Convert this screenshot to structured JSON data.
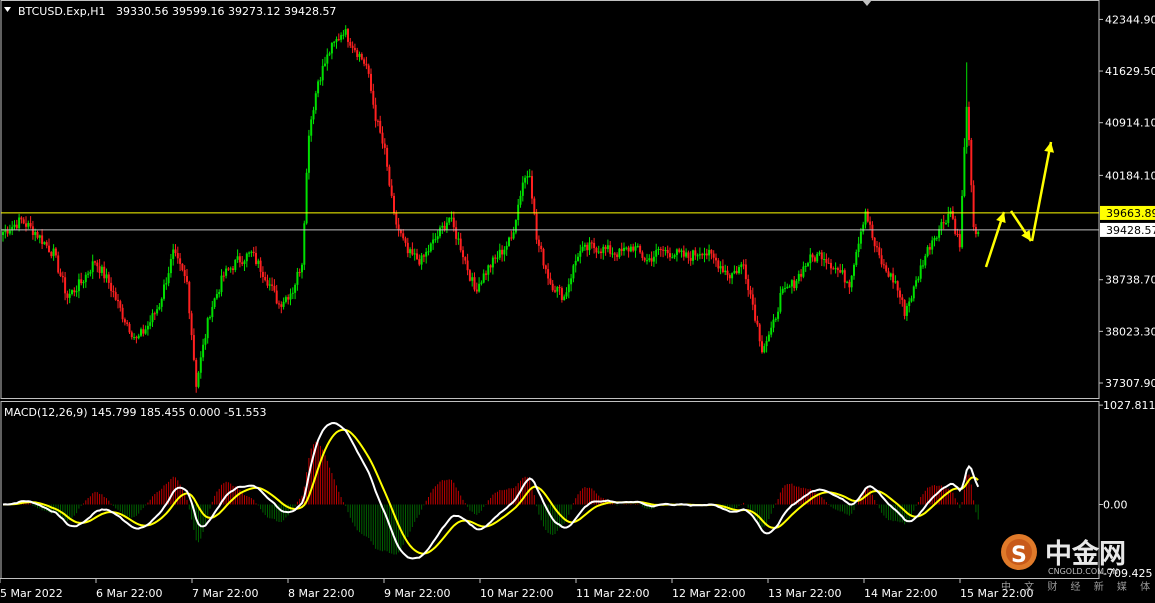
{
  "chart_data": [
    {
      "type": "candlestick",
      "symbol_header": "BTCUSD.Exp,H1",
      "ohlc_header": "39330.56 39599.16 39273.12 39428.57",
      "price_ticks": [
        {
          "label": "42344.90",
          "value": 42344.9
        },
        {
          "label": "41629.50",
          "value": 41629.5
        },
        {
          "label": "40914.10",
          "value": 40914.1
        },
        {
          "label": "40184.10",
          "value": 40184.1
        },
        {
          "label": "38738.70",
          "value": 38738.7
        },
        {
          "label": "38023.30",
          "value": 38023.3
        },
        {
          "label": "37307.90",
          "value": 37307.9
        }
      ],
      "ylim": [
        37100,
        42600
      ],
      "hlines": [
        {
          "label": "39663.89",
          "value": 39663.89,
          "color": "#ffff00",
          "tag_bg": "#ffff00",
          "tag_fg": "#000000"
        },
        {
          "label": "39428.57",
          "value": 39428.57,
          "color": "#c0c0c0",
          "tag_bg": "#ffffff",
          "tag_fg": "#000000"
        }
      ],
      "bull_color": "#00e000",
      "bear_color": "#ff2020",
      "time_labels": [
        "5 Mar 2022",
        "6 Mar 22:00",
        "7 Mar 22:00",
        "8 Mar 22:00",
        "9 Mar 22:00",
        "10 Mar 22:00",
        "11 Mar 22:00",
        "12 Mar 22:00",
        "13 Mar 22:00",
        "14 Mar 22:00",
        "15 Mar 22:00"
      ],
      "anchors": [
        [
          0,
          39400
        ],
        [
          8,
          39560
        ],
        [
          14,
          39400
        ],
        [
          22,
          39100
        ],
        [
          28,
          38500
        ],
        [
          34,
          38700
        ],
        [
          40,
          39000
        ],
        [
          46,
          38700
        ],
        [
          52,
          38250
        ],
        [
          58,
          37900
        ],
        [
          63,
          38100
        ],
        [
          68,
          38400
        ],
        [
          74,
          39100
        ],
        [
          80,
          38700
        ],
        [
          84,
          37300
        ],
        [
          90,
          38300
        ],
        [
          96,
          38800
        ],
        [
          102,
          39000
        ],
        [
          108,
          39100
        ],
        [
          114,
          38800
        ],
        [
          120,
          38400
        ],
        [
          126,
          38600
        ],
        [
          130,
          39000
        ],
        [
          133,
          40800
        ],
        [
          137,
          41500
        ],
        [
          142,
          41900
        ],
        [
          148,
          42200
        ],
        [
          152,
          42000
        ],
        [
          158,
          41700
        ],
        [
          162,
          41000
        ],
        [
          166,
          40500
        ],
        [
          170,
          39600
        ],
        [
          176,
          39100
        ],
        [
          182,
          39000
        ],
        [
          188,
          39300
        ],
        [
          194,
          39600
        ],
        [
          199,
          39200
        ],
        [
          205,
          38600
        ],
        [
          211,
          38900
        ],
        [
          216,
          39100
        ],
        [
          221,
          39300
        ],
        [
          226,
          40100
        ],
        [
          229,
          40250
        ],
        [
          232,
          39300
        ],
        [
          238,
          38700
        ],
        [
          244,
          38500
        ],
        [
          250,
          39100
        ],
        [
          256,
          39200
        ],
        [
          262,
          39150
        ],
        [
          268,
          39100
        ],
        [
          274,
          39200
        ],
        [
          280,
          39000
        ],
        [
          286,
          39150
        ],
        [
          292,
          39100
        ],
        [
          298,
          39050
        ],
        [
          304,
          39150
        ],
        [
          310,
          39000
        ],
        [
          316,
          38800
        ],
        [
          322,
          38950
        ],
        [
          326,
          38400
        ],
        [
          330,
          37800
        ],
        [
          334,
          38000
        ],
        [
          338,
          38500
        ],
        [
          344,
          38700
        ],
        [
          350,
          39000
        ],
        [
          356,
          39100
        ],
        [
          362,
          38900
        ],
        [
          368,
          38700
        ],
        [
          372,
          39300
        ],
        [
          375,
          39700
        ],
        [
          379,
          39200
        ],
        [
          383,
          38900
        ],
        [
          388,
          38700
        ],
        [
          392,
          38300
        ],
        [
          396,
          38600
        ],
        [
          400,
          39000
        ],
        [
          404,
          39300
        ],
        [
          408,
          39500
        ],
        [
          412,
          39700
        ],
        [
          416,
          39200
        ],
        [
          419,
          41200
        ],
        [
          422,
          39400
        ],
        [
          424,
          39430
        ]
      ],
      "forecast_arrows": [
        {
          "from": [
            986,
            267
          ],
          "to": [
            1004,
            212
          ]
        },
        {
          "from": [
            1011,
            211
          ],
          "to": [
            1031,
            241
          ]
        },
        {
          "from": [
            1032,
            241
          ],
          "to": [
            1051,
            142
          ]
        }
      ],
      "forecast_color": "#ffff00"
    },
    {
      "type": "macd",
      "label": "MACD(12,26,9) 145.799 185.455 0.000 -51.553",
      "ticks": [
        {
          "label": "1027.811",
          "value": 1027.811
        },
        {
          "label": "0.00",
          "value": 0
        },
        {
          "label": "-709.425",
          "value": -709.425
        }
      ],
      "ylim": [
        -760,
        1060
      ],
      "macd_color": "#ffffff",
      "signal_color": "#ffff00",
      "hist_pos_color": "#c00000",
      "hist_neg_color": "#006000"
    }
  ],
  "watermark": {
    "brand_cn": "中金网",
    "brand_en": "CNGOLD.COM.CN",
    "tagline": "中 文 财 经 新 媒 体"
  }
}
